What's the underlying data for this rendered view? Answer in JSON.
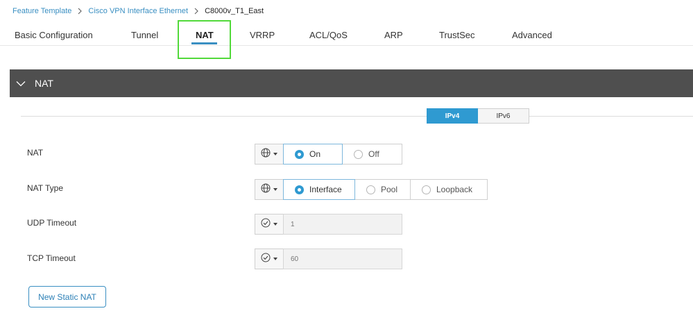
{
  "breadcrumb": {
    "items": [
      "Feature Template",
      "Cisco VPN Interface Ethernet"
    ],
    "current": "C8000v_T1_East"
  },
  "tabs": [
    {
      "label": "Basic Configuration"
    },
    {
      "label": "Tunnel"
    },
    {
      "label": "NAT",
      "active": true
    },
    {
      "label": "VRRP"
    },
    {
      "label": "ACL/QoS"
    },
    {
      "label": "ARP"
    },
    {
      "label": "TrustSec"
    },
    {
      "label": "Advanced"
    }
  ],
  "section": {
    "title": "NAT",
    "toggle_icon": "chevron-down-icon"
  },
  "ip_version": {
    "options": [
      "IPv4",
      "IPv6"
    ],
    "selected": "IPv4"
  },
  "fields": {
    "nat": {
      "label": "NAT",
      "scope_icon": "globe-icon",
      "options": [
        "On",
        "Off"
      ],
      "selected": "On"
    },
    "nat_type": {
      "label": "NAT Type",
      "scope_icon": "globe-icon",
      "options": [
        "Interface",
        "Pool",
        "Loopback"
      ],
      "selected": "Interface"
    },
    "udp_timeout": {
      "label": "UDP Timeout",
      "scope_icon": "check-circle-icon",
      "placeholder": "1"
    },
    "tcp_timeout": {
      "label": "TCP Timeout",
      "scope_icon": "check-circle-icon",
      "placeholder": "60"
    }
  },
  "buttons": {
    "new_static_nat": "New Static NAT"
  },
  "colors": {
    "accent": "#2f9ad1",
    "link": "#3a8fc2",
    "header_bg": "#4f4f4f",
    "highlight": "#52d93a"
  }
}
